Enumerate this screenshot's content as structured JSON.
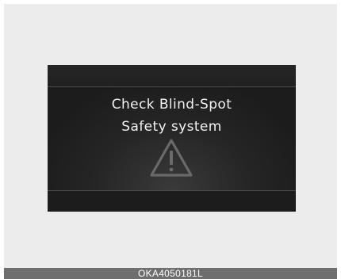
{
  "display": {
    "line1": "Check Blind-Spot",
    "line2": "Safety system",
    "icon": "warning-triangle-icon"
  },
  "caption": {
    "code": "OKA4050181L"
  },
  "colors": {
    "background": "#ececec",
    "display": "#1e1e1e",
    "text": "#f2f2f2",
    "icon": "#6a6a6a",
    "caption_bar": "#6e6e6e"
  }
}
